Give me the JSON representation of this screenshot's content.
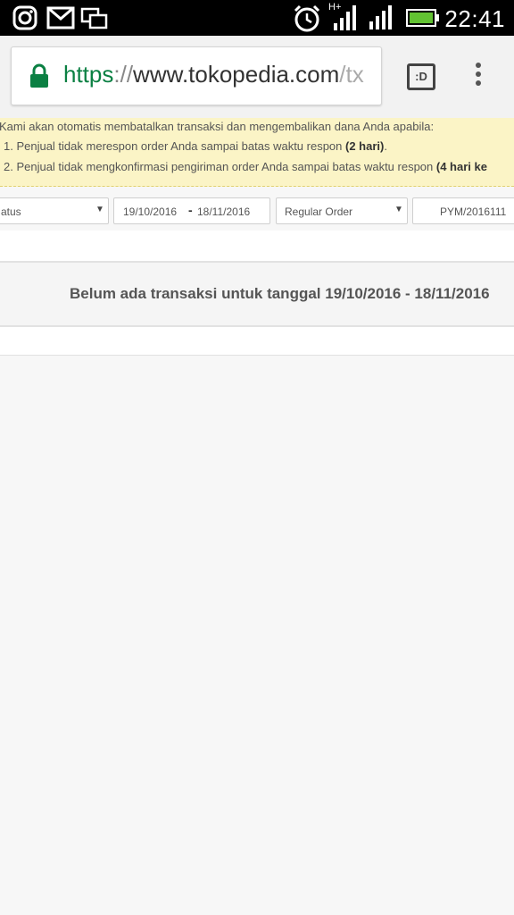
{
  "statusbar": {
    "time": "22:41",
    "network_label": "H+",
    "icons": [
      "instagram-icon",
      "gmail-icon",
      "screenshot-icon",
      "alarm-icon",
      "signal-icon",
      "battery-icon"
    ]
  },
  "browser": {
    "url_scheme": "https",
    "url_sep": "://",
    "url_host": "www.tokopedia.com",
    "url_path": "/tx",
    "tab_label": ":D",
    "accent": "#0b8043"
  },
  "notice": {
    "intro": "Kami akan otomatis membatalkan transaksi dan mengembalikan dana Anda apabila:",
    "item1_text": "1. Penjual tidak merespon order Anda sampai batas waktu respon ",
    "item1_bold": "(2 hari)",
    "item1_end": ".",
    "item2_text": "2. Penjual tidak mengkonfirmasi pengiriman order Anda sampai batas waktu respon ",
    "item2_bold": "(4 hari ke",
    "bg_color": "#fbf4c6"
  },
  "filters": {
    "status_label": "atus",
    "date_from": "19/10/2016",
    "date_sep": "-",
    "date_to": "18/11/2016",
    "order_type": "Regular Order",
    "invoice": "PYM/2016111"
  },
  "results": {
    "empty_message": "Belum ada transaksi untuk tanggal 19/10/2016 - 18/11/2016"
  }
}
